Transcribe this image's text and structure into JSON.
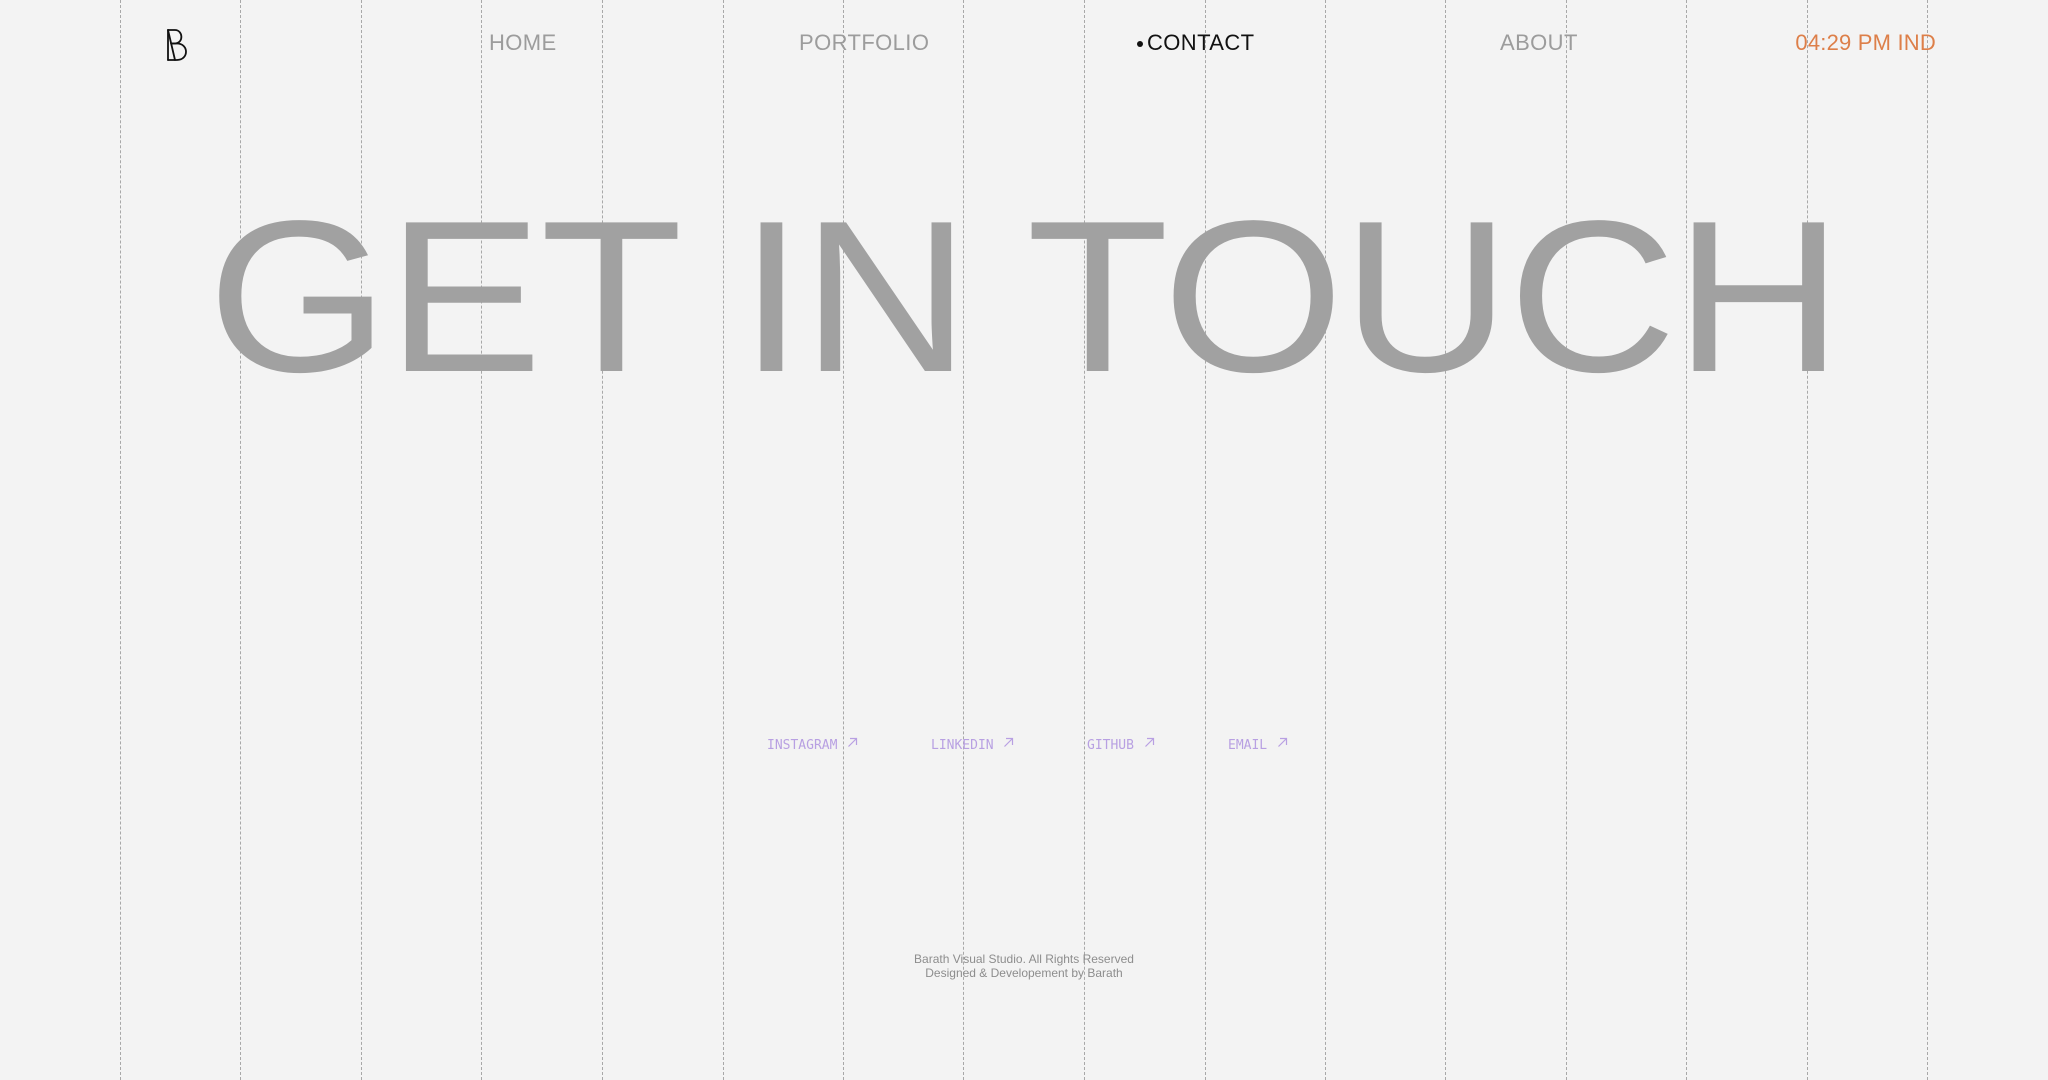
{
  "nav": {
    "items": [
      {
        "label": "HOME"
      },
      {
        "label": "PORTFOLIO"
      },
      {
        "label": "CONTACT"
      },
      {
        "label": "ABOUT"
      }
    ],
    "active": "CONTACT",
    "clock": "04:29 PM IND"
  },
  "hero": {
    "title": "GET IN TOUCH"
  },
  "social": {
    "links": [
      {
        "label": "INSTAGRAM",
        "icon": "arrow-up-right-icon"
      },
      {
        "label": "LINKEDIN",
        "icon": "arrow-up-right-icon"
      },
      {
        "label": "GITHUB",
        "icon": "arrow-up-right-icon"
      },
      {
        "label": "EMAIL",
        "icon": "arrow-up-right-icon"
      }
    ]
  },
  "footer": {
    "line1": "Barath Visual Studio. All Rights Reserved",
    "line2": "Designed & Developement by Barath"
  },
  "colors": {
    "background": "#f3f3f3",
    "grid_line": "#a8a8a8",
    "nav_text": "#9c9c9c",
    "nav_active": "#111111",
    "clock": "#dd7f49",
    "hero_text": "#a1a1a1",
    "social_link": "#b8a0e2",
    "footer_text": "#8d8d8d"
  },
  "icons": {
    "logo": "monogram-logo",
    "link_arrow": "arrow-up-right-icon"
  }
}
